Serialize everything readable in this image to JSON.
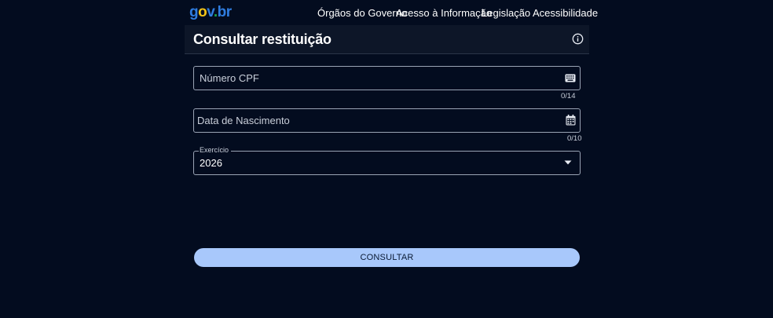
{
  "brand": {
    "logo_text": "govbr",
    "colors": {
      "blue": "#2f7de0",
      "yellow": "#f2c318",
      "green": "#1aa34a"
    }
  },
  "nav": {
    "links": [
      "Órgãos do Governo",
      "Acesso à Informação",
      "Legislação",
      "Acessibilidade"
    ]
  },
  "header": {
    "title": "Consultar restituição",
    "info_icon": "info-circle-icon"
  },
  "form": {
    "cpf": {
      "label": "Número CPF",
      "counter": "0/14",
      "icon": "keyboard-icon"
    },
    "birth": {
      "label": "Data de Nascimento",
      "counter": "0/10",
      "icon": "calendar-icon"
    },
    "exercise": {
      "legend": "Exercício",
      "value": "2026",
      "icon": "chevron-down-icon"
    }
  },
  "actions": {
    "submit_label": "CONSULTAR"
  },
  "theme": {
    "background": "#030c1f",
    "header_bg": "#0d1628",
    "button_bg": "#a8c8fb"
  }
}
